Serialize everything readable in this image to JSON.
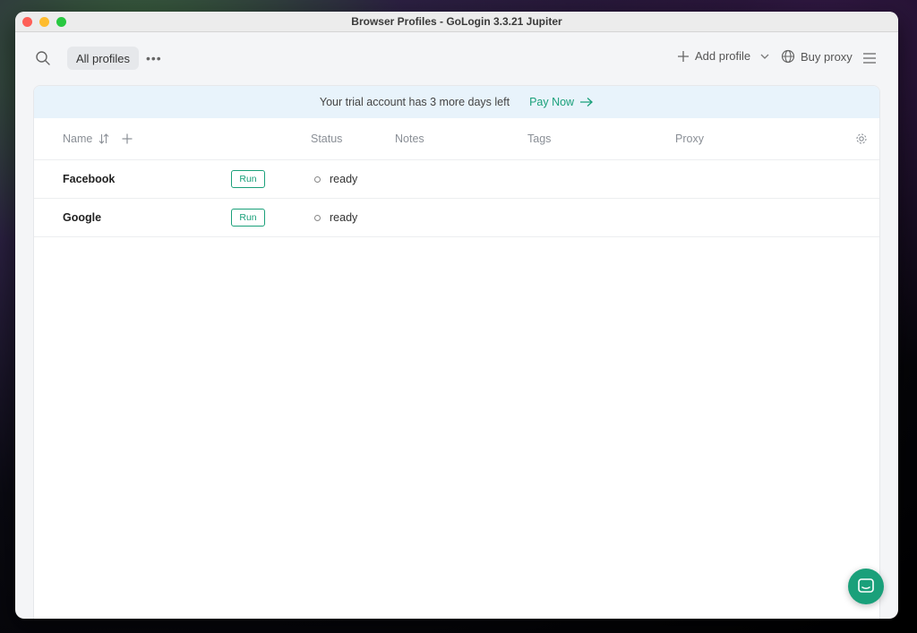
{
  "window": {
    "title": "Browser Profiles - GoLogin 3.3.21 Jupiter"
  },
  "toolbar": {
    "tab_label": "All profiles",
    "add_profile_label": "Add profile",
    "buy_proxy_label": "Buy proxy"
  },
  "banner": {
    "text": "Your trial account has 3 more days left",
    "pay_label": "Pay Now"
  },
  "table": {
    "columns": {
      "name": "Name",
      "status": "Status",
      "notes": "Notes",
      "tags": "Tags",
      "proxy": "Proxy"
    },
    "rows": [
      {
        "name": "Facebook",
        "run_label": "Run",
        "status": "ready"
      },
      {
        "name": "Google",
        "run_label": "Run",
        "status": "ready"
      }
    ]
  },
  "colors": {
    "accent": "#1aa07a",
    "banner_bg": "#e8f3fb"
  },
  "icons": [
    "search-icon",
    "more-icon",
    "plus-icon",
    "chevron-down-icon",
    "globe-icon",
    "menu-icon",
    "sort-icon",
    "gear-icon",
    "chat-icon",
    "arrow-right-icon"
  ]
}
